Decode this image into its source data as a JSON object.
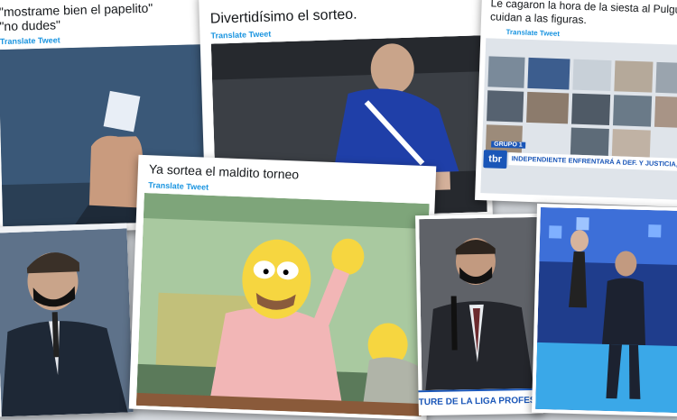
{
  "cards": {
    "papelito": {
      "caption": "\"mostrame bien el papelito\"\n\"no dudes\"",
      "translate": "Translate Tweet"
    },
    "sorteo": {
      "caption": "Divertidísimo el sorteo.",
      "translate": "Translate Tweet"
    },
    "siesta": {
      "caption": "Le cagaron la hora de la siesta al Pulguita pa\ncuidan a las figuras.",
      "translate": "Translate Tweet",
      "banner_text": "INDEPENDIENTE ENFRENTARÁ A DEF. Y JUSTICIA, CENTRAL CÓRDOBA (SE",
      "banner_logo": "tbr",
      "banner_tag": "GRUPO 1"
    },
    "torneo": {
      "caption": "Ya sortea el maldito torneo",
      "translate": "Translate Tweet"
    },
    "liga": {
      "banner_text": "TURE DE LA LIGA PROFESIO"
    }
  },
  "colors": {
    "twitter_blue": "#1b95e0",
    "banner_blue": "#1a56b8",
    "stage_blue": "#2b7be0"
  }
}
